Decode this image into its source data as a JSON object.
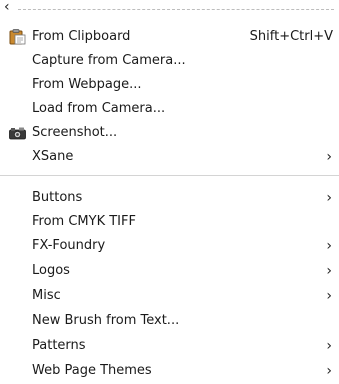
{
  "menu": {
    "back_glyph": "‹",
    "items": [
      {
        "label": "From Clipboard",
        "accel": "Shift+Ctrl+V",
        "icon": "clipboard-paste-icon"
      },
      {
        "label": "Capture from Camera..."
      },
      {
        "label": "From Webpage..."
      },
      {
        "label": "Load from Camera..."
      },
      {
        "label": "Screenshot...",
        "icon": "camera-icon"
      },
      {
        "label": "XSane",
        "submenu": true
      },
      {
        "label": "Buttons",
        "submenu": true
      },
      {
        "label": "From CMYK TIFF"
      },
      {
        "label": "FX-Foundry",
        "submenu": true
      },
      {
        "label": "Logos",
        "submenu": true
      },
      {
        "label": "Misc",
        "submenu": true
      },
      {
        "label": "New Brush from Text..."
      },
      {
        "label": "Patterns",
        "submenu": true
      },
      {
        "label": "Web Page Themes",
        "submenu": true
      }
    ],
    "submenu_glyph": "›"
  }
}
